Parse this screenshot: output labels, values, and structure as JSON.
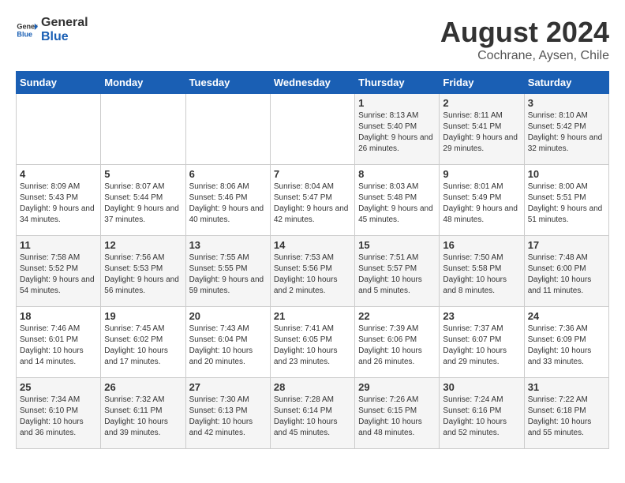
{
  "header": {
    "logo": {
      "general": "General",
      "blue": "Blue"
    },
    "title": "August 2024",
    "subtitle": "Cochrane, Aysen, Chile"
  },
  "days_of_week": [
    "Sunday",
    "Monday",
    "Tuesday",
    "Wednesday",
    "Thursday",
    "Friday",
    "Saturday"
  ],
  "weeks": [
    [
      {
        "day": "",
        "sunrise": "",
        "sunset": "",
        "daylight": ""
      },
      {
        "day": "",
        "sunrise": "",
        "sunset": "",
        "daylight": ""
      },
      {
        "day": "",
        "sunrise": "",
        "sunset": "",
        "daylight": ""
      },
      {
        "day": "",
        "sunrise": "",
        "sunset": "",
        "daylight": ""
      },
      {
        "day": "1",
        "sunrise": "Sunrise: 8:13 AM",
        "sunset": "Sunset: 5:40 PM",
        "daylight": "Daylight: 9 hours and 26 minutes."
      },
      {
        "day": "2",
        "sunrise": "Sunrise: 8:11 AM",
        "sunset": "Sunset: 5:41 PM",
        "daylight": "Daylight: 9 hours and 29 minutes."
      },
      {
        "day": "3",
        "sunrise": "Sunrise: 8:10 AM",
        "sunset": "Sunset: 5:42 PM",
        "daylight": "Daylight: 9 hours and 32 minutes."
      }
    ],
    [
      {
        "day": "4",
        "sunrise": "Sunrise: 8:09 AM",
        "sunset": "Sunset: 5:43 PM",
        "daylight": "Daylight: 9 hours and 34 minutes."
      },
      {
        "day": "5",
        "sunrise": "Sunrise: 8:07 AM",
        "sunset": "Sunset: 5:44 PM",
        "daylight": "Daylight: 9 hours and 37 minutes."
      },
      {
        "day": "6",
        "sunrise": "Sunrise: 8:06 AM",
        "sunset": "Sunset: 5:46 PM",
        "daylight": "Daylight: 9 hours and 40 minutes."
      },
      {
        "day": "7",
        "sunrise": "Sunrise: 8:04 AM",
        "sunset": "Sunset: 5:47 PM",
        "daylight": "Daylight: 9 hours and 42 minutes."
      },
      {
        "day": "8",
        "sunrise": "Sunrise: 8:03 AM",
        "sunset": "Sunset: 5:48 PM",
        "daylight": "Daylight: 9 hours and 45 minutes."
      },
      {
        "day": "9",
        "sunrise": "Sunrise: 8:01 AM",
        "sunset": "Sunset: 5:49 PM",
        "daylight": "Daylight: 9 hours and 48 minutes."
      },
      {
        "day": "10",
        "sunrise": "Sunrise: 8:00 AM",
        "sunset": "Sunset: 5:51 PM",
        "daylight": "Daylight: 9 hours and 51 minutes."
      }
    ],
    [
      {
        "day": "11",
        "sunrise": "Sunrise: 7:58 AM",
        "sunset": "Sunset: 5:52 PM",
        "daylight": "Daylight: 9 hours and 54 minutes."
      },
      {
        "day": "12",
        "sunrise": "Sunrise: 7:56 AM",
        "sunset": "Sunset: 5:53 PM",
        "daylight": "Daylight: 9 hours and 56 minutes."
      },
      {
        "day": "13",
        "sunrise": "Sunrise: 7:55 AM",
        "sunset": "Sunset: 5:55 PM",
        "daylight": "Daylight: 9 hours and 59 minutes."
      },
      {
        "day": "14",
        "sunrise": "Sunrise: 7:53 AM",
        "sunset": "Sunset: 5:56 PM",
        "daylight": "Daylight: 10 hours and 2 minutes."
      },
      {
        "day": "15",
        "sunrise": "Sunrise: 7:51 AM",
        "sunset": "Sunset: 5:57 PM",
        "daylight": "Daylight: 10 hours and 5 minutes."
      },
      {
        "day": "16",
        "sunrise": "Sunrise: 7:50 AM",
        "sunset": "Sunset: 5:58 PM",
        "daylight": "Daylight: 10 hours and 8 minutes."
      },
      {
        "day": "17",
        "sunrise": "Sunrise: 7:48 AM",
        "sunset": "Sunset: 6:00 PM",
        "daylight": "Daylight: 10 hours and 11 minutes."
      }
    ],
    [
      {
        "day": "18",
        "sunrise": "Sunrise: 7:46 AM",
        "sunset": "Sunset: 6:01 PM",
        "daylight": "Daylight: 10 hours and 14 minutes."
      },
      {
        "day": "19",
        "sunrise": "Sunrise: 7:45 AM",
        "sunset": "Sunset: 6:02 PM",
        "daylight": "Daylight: 10 hours and 17 minutes."
      },
      {
        "day": "20",
        "sunrise": "Sunrise: 7:43 AM",
        "sunset": "Sunset: 6:04 PM",
        "daylight": "Daylight: 10 hours and 20 minutes."
      },
      {
        "day": "21",
        "sunrise": "Sunrise: 7:41 AM",
        "sunset": "Sunset: 6:05 PM",
        "daylight": "Daylight: 10 hours and 23 minutes."
      },
      {
        "day": "22",
        "sunrise": "Sunrise: 7:39 AM",
        "sunset": "Sunset: 6:06 PM",
        "daylight": "Daylight: 10 hours and 26 minutes."
      },
      {
        "day": "23",
        "sunrise": "Sunrise: 7:37 AM",
        "sunset": "Sunset: 6:07 PM",
        "daylight": "Daylight: 10 hours and 29 minutes."
      },
      {
        "day": "24",
        "sunrise": "Sunrise: 7:36 AM",
        "sunset": "Sunset: 6:09 PM",
        "daylight": "Daylight: 10 hours and 33 minutes."
      }
    ],
    [
      {
        "day": "25",
        "sunrise": "Sunrise: 7:34 AM",
        "sunset": "Sunset: 6:10 PM",
        "daylight": "Daylight: 10 hours and 36 minutes."
      },
      {
        "day": "26",
        "sunrise": "Sunrise: 7:32 AM",
        "sunset": "Sunset: 6:11 PM",
        "daylight": "Daylight: 10 hours and 39 minutes."
      },
      {
        "day": "27",
        "sunrise": "Sunrise: 7:30 AM",
        "sunset": "Sunset: 6:13 PM",
        "daylight": "Daylight: 10 hours and 42 minutes."
      },
      {
        "day": "28",
        "sunrise": "Sunrise: 7:28 AM",
        "sunset": "Sunset: 6:14 PM",
        "daylight": "Daylight: 10 hours and 45 minutes."
      },
      {
        "day": "29",
        "sunrise": "Sunrise: 7:26 AM",
        "sunset": "Sunset: 6:15 PM",
        "daylight": "Daylight: 10 hours and 48 minutes."
      },
      {
        "day": "30",
        "sunrise": "Sunrise: 7:24 AM",
        "sunset": "Sunset: 6:16 PM",
        "daylight": "Daylight: 10 hours and 52 minutes."
      },
      {
        "day": "31",
        "sunrise": "Sunrise: 7:22 AM",
        "sunset": "Sunset: 6:18 PM",
        "daylight": "Daylight: 10 hours and 55 minutes."
      }
    ]
  ]
}
